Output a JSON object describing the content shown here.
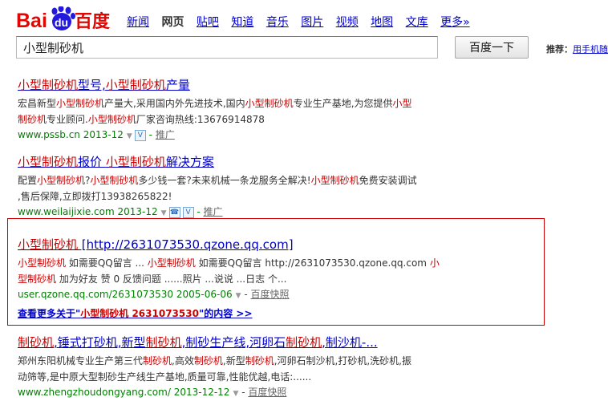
{
  "brand": {
    "logo_text_latin": "Bai",
    "logo_text_du": "du",
    "logo_text_cn": "百度",
    "colors": {
      "red": "#e10601",
      "blue": "#2319dc"
    }
  },
  "nav": [
    "新闻",
    "网页",
    "贴吧",
    "知道",
    "音乐",
    "图片",
    "视频",
    "地图",
    "文库",
    "更多»"
  ],
  "nav_active_index": 1,
  "search": {
    "value": "小型制砂机",
    "button_label": "百度一下"
  },
  "recommend": {
    "label": "推荐：",
    "link": "用手机随"
  },
  "results": [
    {
      "title_parts": [
        "小型制砂机",
        "型号,",
        "小型制砂机",
        "产量"
      ],
      "abstract_lines": [
        [
          "宏昌新型",
          "小型制砂机",
          "产量大,采用国内外先进技术,国内",
          "小型制砂机",
          "专业生产基地,为您提供",
          "小型"
        ],
        [
          "制砂机",
          "专业顾问.",
          "小型制砂机",
          "厂家咨询热线:13676914878"
        ]
      ],
      "url": "www.pssb.cn",
      "date": "2013-12",
      "tail_link": "推广"
    },
    {
      "title_parts": [
        "小型制砂机",
        "报价",
        "小型制砂机",
        "解决方案"
      ],
      "abstract_lines": [
        [
          "配置",
          "小型制砂机",
          "?",
          "小型制砂机",
          "多少钱一套?未来机械一条龙服务全解决!",
          "小型制砂机",
          "免费安装调试"
        ],
        [
          ",售后保障,立即拨打13938265822!"
        ]
      ],
      "url": "www.weilaijixie.com",
      "date": "2013-12",
      "tail_link": "推广"
    },
    {
      "title_parts": [
        "小型制砂机",
        " [http://2631073530.qzone.qq.com]"
      ],
      "abstract_lines": [
        [
          "小型制砂机",
          " 如需要QQ留言 ... ",
          "小型制砂机",
          " 如需要QQ留言 http://2631073530.qzone.qq.com ",
          "小"
        ],
        [
          "型制砂机",
          " 加为好友 赞 0 反馈问题 ......照片 ...说说 ...日志 个..."
        ]
      ],
      "url": "user.qzone.qq.com/2631073530",
      "date": "2005-06-06",
      "tail_link": "百度快照",
      "more": [
        "查看更多关于\"",
        "小型制砂机 2631073530",
        "\"的内容 >>"
      ]
    },
    {
      "title_parts": [
        "制砂机",
        ",锤式打砂机,新型",
        "制砂机",
        ",制砂生产线,河卵石",
        "制砂机",
        ",制沙机-..."
      ],
      "abstract_lines": [
        [
          "郑州东阳机械专业生产第三代",
          "制砂机",
          ",高效",
          "制砂机",
          ",新型",
          "制砂机",
          ",河卵石制沙机,打砂机,洗砂机,振"
        ],
        [
          "动筛等,是中原大型制砂生产线生产基地,质量可靠,性能优越,电话:......"
        ]
      ],
      "url": "www.zhengzhoudongyang.com/",
      "date": "2013-12-12",
      "tail_link": "百度快照"
    }
  ]
}
